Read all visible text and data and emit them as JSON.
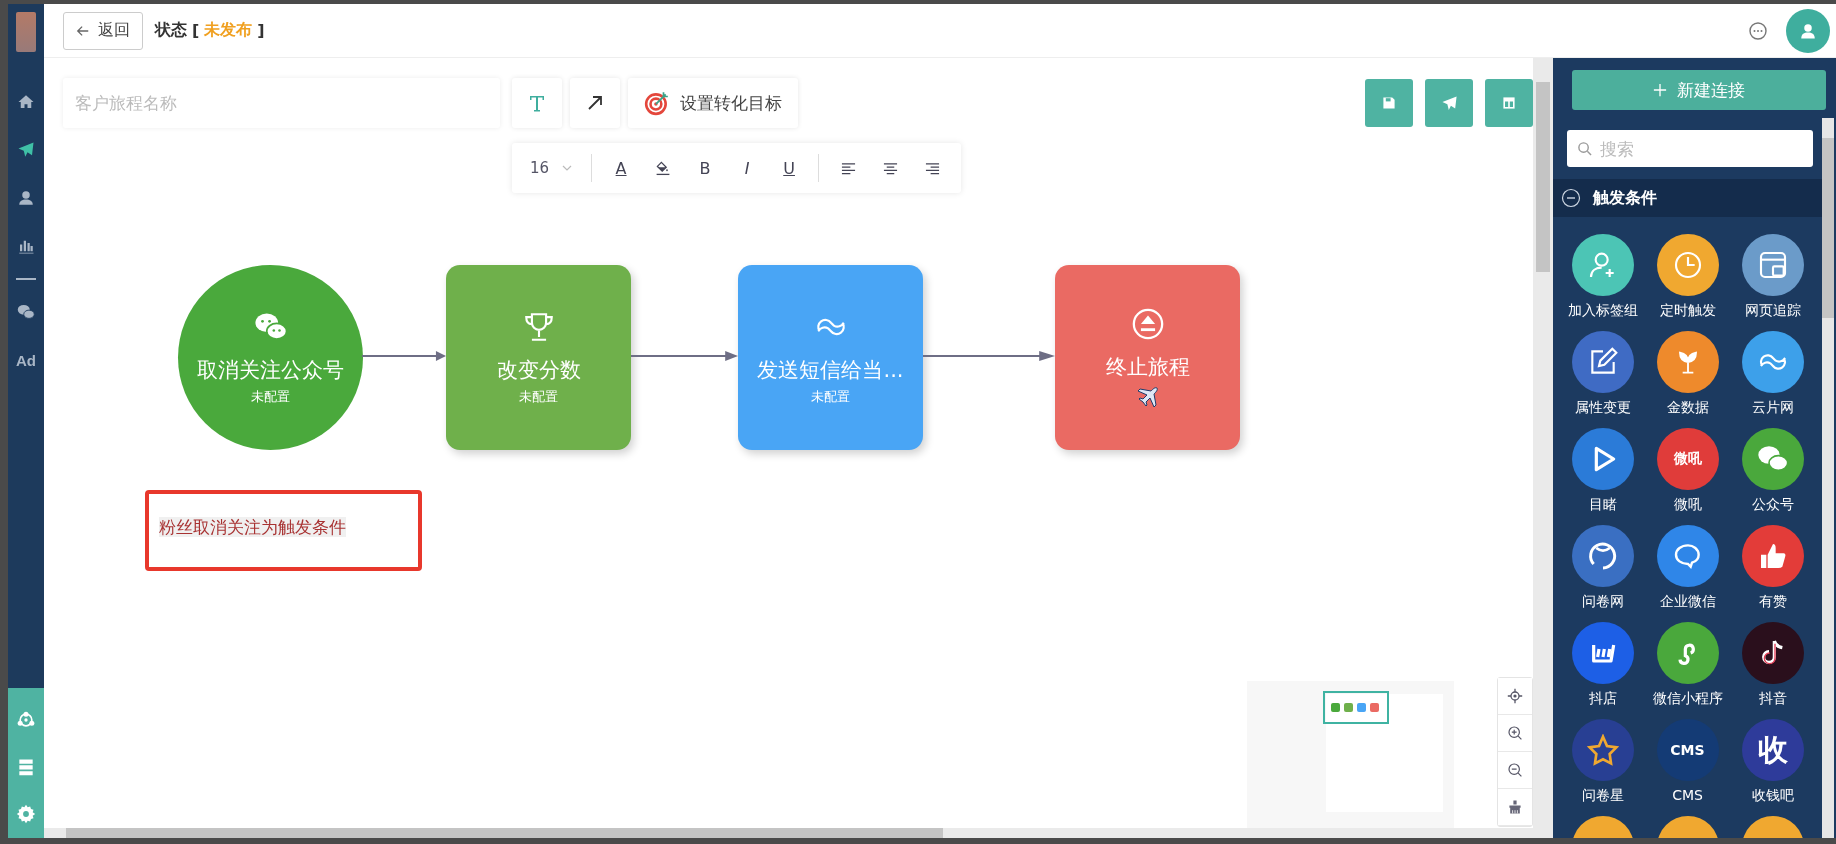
{
  "header": {
    "back_button": "返回",
    "status_label": "状态",
    "status_open": "[",
    "status_value": "未发布",
    "status_close": "]"
  },
  "sidebar": {
    "items": [
      {
        "kind": "home",
        "selected": false
      },
      {
        "kind": "send",
        "selected": true
      },
      {
        "kind": "user",
        "selected": false
      },
      {
        "kind": "chart",
        "selected": false
      },
      {
        "kind": "wechat",
        "selected": false
      },
      {
        "kind": "ad",
        "label": "Ad",
        "selected": false
      }
    ],
    "bottom_items": [
      {
        "kind": "network"
      },
      {
        "kind": "server"
      },
      {
        "kind": "settings"
      }
    ]
  },
  "canvas": {
    "name_placeholder": "客户旅程名称",
    "tools": [
      {
        "kind": "text",
        "selected": true
      },
      {
        "kind": "arrow",
        "selected": false
      }
    ],
    "goal_button": "设置转化目标",
    "format_toolbar": {
      "font_size": "16",
      "buttons": [
        {
          "kind": "color",
          "label": "A"
        },
        {
          "kind": "fill"
        },
        {
          "kind": "bold",
          "label": "B"
        },
        {
          "kind": "italic",
          "label": "I"
        },
        {
          "kind": "underline",
          "label": "U"
        },
        {
          "kind": "align-left"
        },
        {
          "kind": "align-center"
        },
        {
          "kind": "align-right"
        }
      ]
    },
    "nodes": [
      {
        "kind": "trigger",
        "title": "取消关注公众号",
        "subtitle": "未配置",
        "color": "#4aa93c"
      },
      {
        "kind": "action",
        "title": "改变分数",
        "subtitle": "未配置",
        "color": "#6fb04b"
      },
      {
        "kind": "action",
        "title": "发送短信给当...",
        "subtitle": "未配置",
        "color": "#49a5f5"
      },
      {
        "kind": "end",
        "title": "终止旅程",
        "color": "#ea6a63"
      }
    ],
    "note": "粉丝取消关注为触发条件"
  },
  "panel": {
    "new_button": "新建连接",
    "search_placeholder": "搜索",
    "section": {
      "title": "触发条件",
      "expanded": true
    },
    "items": [
      {
        "kind": "person-add",
        "label": "加入标签组",
        "color": "#4cc5b5"
      },
      {
        "kind": "clock",
        "label": "定时触发",
        "color": "#f0a830"
      },
      {
        "kind": "browser",
        "label": "网页追踪",
        "color": "#6b9bc9"
      },
      {
        "kind": "edit",
        "label": "属性变更",
        "color": "#3f6bc4"
      },
      {
        "kind": "tree",
        "label": "金数据",
        "color": "#ee8a2c"
      },
      {
        "kind": "cloud",
        "label": "云片网",
        "color": "#3da0ea"
      },
      {
        "kind": "play",
        "label": "目睹",
        "color": "#2b7bd8"
      },
      {
        "kind": "text",
        "badge_text": "微吼",
        "label": "微吼",
        "color": "#e03c3a"
      },
      {
        "kind": "wechat",
        "label": "公众号",
        "color": "#4aa83c"
      },
      {
        "kind": "face",
        "label": "问卷网",
        "color": "#3a6fc2"
      },
      {
        "kind": "chat",
        "label": "企业微信",
        "color": "#2f86e8"
      },
      {
        "kind": "thumb",
        "label": "有赞",
        "color": "#e33c39"
      },
      {
        "kind": "shop",
        "label": "抖店",
        "color": "#1d5fe6"
      },
      {
        "kind": "link",
        "label": "微信小程序",
        "color": "#4aa83c"
      },
      {
        "kind": "note",
        "label": "抖音",
        "color": "#2a0f1c"
      },
      {
        "kind": "star",
        "label": "问卷星",
        "color": "#283f93"
      },
      {
        "kind": "text",
        "badge_text": "CMS",
        "label": "CMS",
        "color": "#143b75"
      },
      {
        "kind": "text",
        "badge_text": "收",
        "label": "收钱吧",
        "color": "#2e3b9a"
      },
      {
        "kind": "blank",
        "color": "#f0a830"
      },
      {
        "kind": "blank",
        "color": "#f0a830"
      },
      {
        "kind": "blank",
        "color": "#f0a830"
      }
    ]
  }
}
